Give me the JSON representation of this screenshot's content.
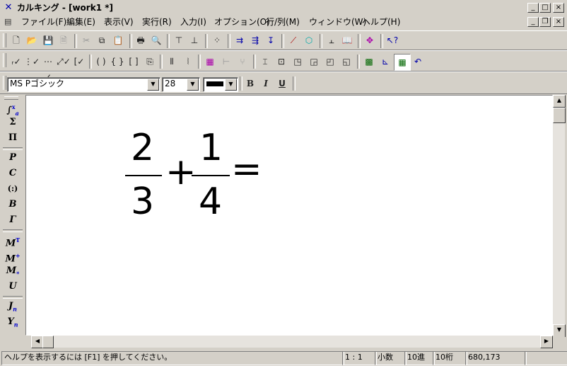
{
  "window": {
    "app_name": "カルキング",
    "doc_title": "[work1 *]",
    "separator": " - ",
    "minimize": "_",
    "maximize": "□",
    "close": "×",
    "restore": "❐"
  },
  "menu": [
    "ファイル(F)",
    "編集(E)",
    "表示(V)",
    "実行(R)",
    "入力(I)",
    "オプション(O)",
    "行/列(M)",
    "ウィンドウ(W)",
    "ヘルプ(H)"
  ],
  "format": {
    "font_name": "MS Pゴシック",
    "font_size": "28",
    "bold": "B",
    "italic": "I",
    "underline": "U"
  },
  "palette": [
    "∫",
    "Σ",
    "Π",
    "P",
    "C",
    "(:)",
    "B",
    "Γ",
    "M",
    "M",
    "M",
    "U",
    "J",
    "Y"
  ],
  "palette_sup": {
    "0": "x",
    "8": "T",
    "9": "+"
  },
  "palette_sub": {
    "0": "a",
    "10": "*",
    "12": "n",
    "13": "n"
  },
  "expression": {
    "frac1_num": "2",
    "frac1_den": "3",
    "plus": "+",
    "frac2_num": "1",
    "frac2_den": "4",
    "equals": "="
  },
  "status": {
    "help": "ヘルプを表示するには [F1] を押してください。",
    "position": "1 : 1",
    "mode": "小数",
    "base": "10進",
    "digits": "10桁",
    "coords": "680,173"
  }
}
